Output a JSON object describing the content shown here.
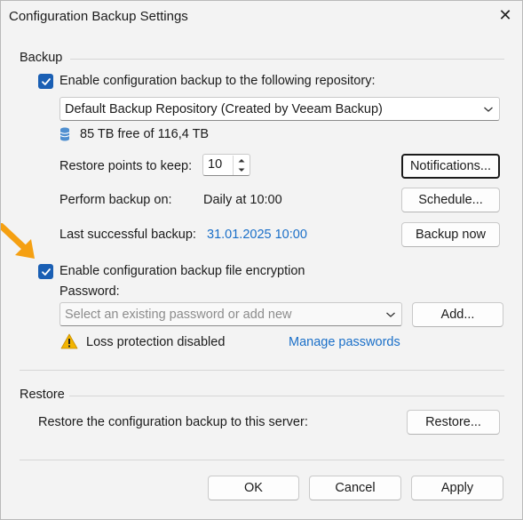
{
  "window": {
    "title": "Configuration Backup Settings",
    "close_glyph": "✕"
  },
  "backup": {
    "section_label": "Backup",
    "enable_label": "Enable configuration backup to the following repository:",
    "enable_checked": true,
    "repository_value": "Default Backup Repository (Created by Veeam Backup)",
    "storage_icon": "database-icon",
    "free_space": "85 TB free of 116,4 TB",
    "restore_points_label": "Restore points to keep:",
    "restore_points_value": "10",
    "notifications_button": "Notifications...",
    "perform_label": "Perform backup on:",
    "perform_value": "Daily at 10:00",
    "schedule_button": "Schedule...",
    "last_label": "Last successful backup:",
    "last_value": "31.01.2025 10:00",
    "backup_now_button": "Backup now"
  },
  "encryption": {
    "enable_label": "Enable configuration backup file encryption",
    "enable_checked": true,
    "password_label": "Password:",
    "password_placeholder": "Select an existing password or add new",
    "add_button": "Add...",
    "warning_icon": "warning-icon",
    "warning_text": "Loss protection disabled",
    "manage_link": "Manage passwords"
  },
  "restore": {
    "section_label": "Restore",
    "description": "Restore the configuration backup to this server:",
    "restore_button": "Restore..."
  },
  "footer": {
    "ok": "OK",
    "cancel": "Cancel",
    "apply": "Apply"
  },
  "annotation": {
    "arrow_color": "#f5a012"
  },
  "colors": {
    "accent": "#1a5fb4",
    "link": "#1a6fc8",
    "warning": "#f2b400"
  }
}
